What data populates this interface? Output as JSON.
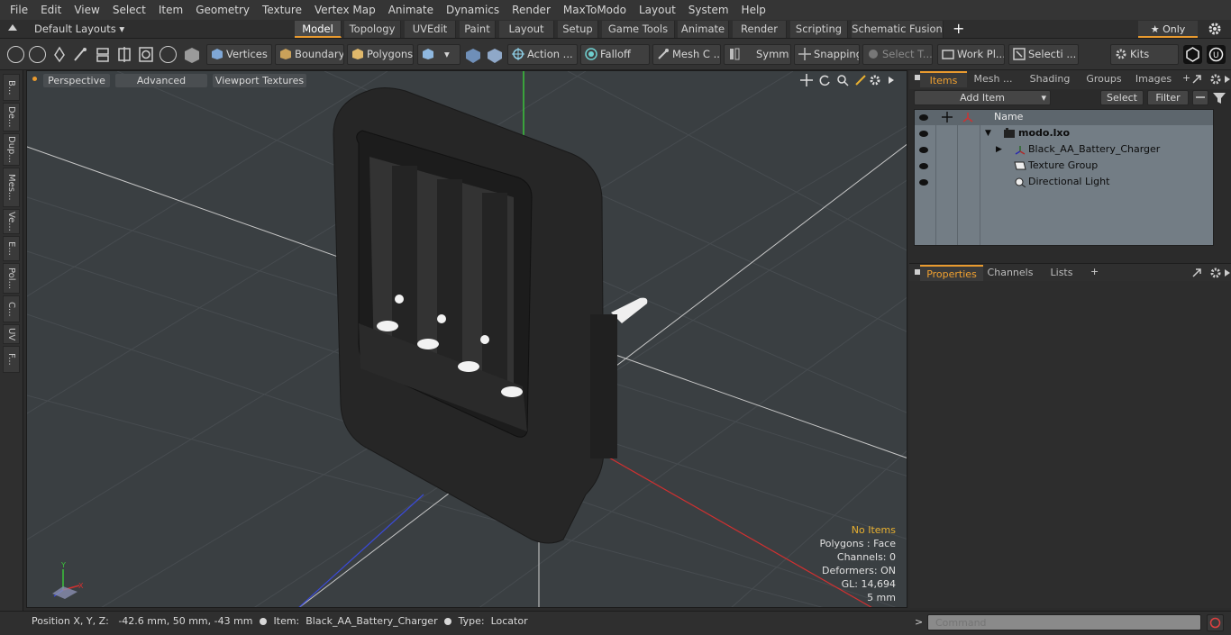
{
  "menu": [
    "File",
    "Edit",
    "View",
    "Select",
    "Item",
    "Geometry",
    "Texture",
    "Vertex Map",
    "Animate",
    "Dynamics",
    "Render",
    "MaxToModo",
    "Layout",
    "System",
    "Help"
  ],
  "layout_selector": "Default Layouts ▾",
  "layout_tabs": [
    "Model",
    "Topology",
    "UVEdit",
    "Paint",
    "Layout",
    "Setup",
    "Game Tools",
    "Animate",
    "Render",
    "Scripting",
    "Schematic Fusion"
  ],
  "add_tab": "+",
  "only_label": "★ Only",
  "toolbar": {
    "vertices": "Vertices",
    "boundary": "Boundary",
    "polygons": "Polygons",
    "action": "Action",
    "falloff": "Falloff",
    "mesh_c": "Mesh C ...",
    "symm": "Symm ...",
    "snapping": "Snapping",
    "select_t": "Select T...",
    "work_pl": "Work Pl...",
    "selecti": "Selecti ...",
    "kits": "Kits"
  },
  "left_tabs": [
    "B...",
    "De...",
    "Dup...",
    "Mes...",
    "Ve...",
    "E...",
    "Pol...",
    "C...",
    "UV",
    "F..."
  ],
  "viewport": {
    "perspective": "Perspective",
    "advanced": "Advanced",
    "viewport_textures": "Viewport Textures",
    "info": {
      "no_items": "No Items",
      "polygons": "Polygons : Face",
      "channels": "Channels: 0",
      "deformers": "Deformers: ON",
      "gl": "GL: 14,694",
      "scale": "5 mm"
    },
    "axis_y": "Y",
    "axis_x": "X"
  },
  "items_panel": {
    "tabs": [
      "Items",
      "Mesh ...",
      "Shading",
      "Groups",
      "Images"
    ],
    "add_item": "Add Item",
    "select": "Select",
    "filter": "Filter",
    "name_header": "Name",
    "rows": [
      {
        "label": "modo.lxo",
        "indent": 0
      },
      {
        "label": "Black_AA_Battery_Charger",
        "indent": 1
      },
      {
        "label": "Texture Group",
        "indent": 1
      },
      {
        "label": "Directional Light",
        "indent": 1
      }
    ]
  },
  "properties_panel": {
    "tabs": [
      "Properties",
      "Channels",
      "Lists"
    ],
    "add": "+"
  },
  "status": {
    "position_label": "Position X, Y, Z:",
    "position_value": "-42.6 mm, 50 mm, -43 mm",
    "item_label": "Item:",
    "item_value": "Black_AA_Battery_Charger",
    "type_label": "Type:",
    "type_value": "Locator"
  },
  "command_placeholder": "Command",
  "colors": {
    "accent": "#e89a2f",
    "item_list_bg": "#737d85",
    "viewport_bg": "#3a3f42"
  }
}
